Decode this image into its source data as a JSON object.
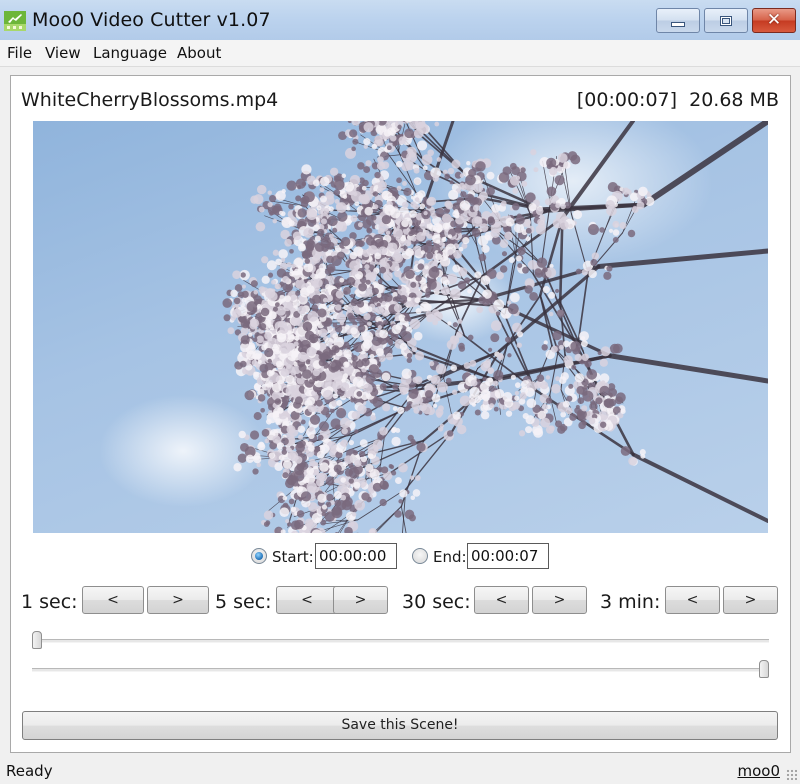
{
  "window": {
    "title": "Moo0 Video Cutter v1.07",
    "app_icon": "clapperboard-icon",
    "controls": {
      "minimize": "minimize-icon",
      "maximize": "maximize-icon",
      "close": "close-icon"
    }
  },
  "menu": {
    "items": [
      {
        "label": "File"
      },
      {
        "label": "View"
      },
      {
        "label": "Language"
      },
      {
        "label": "About"
      }
    ]
  },
  "file": {
    "name": "WhiteCherryBlossoms.mp4",
    "duration": "[00:00:07]",
    "size": "20.68 MB",
    "info": "[00:00:07]  20.68 MB"
  },
  "video": {
    "content": "cherry blossom branches against blue sky"
  },
  "range": {
    "selected": "start",
    "start_label": "Start:",
    "start_value": "00:00:00",
    "end_label": "End:",
    "end_value": "00:00:07"
  },
  "steps": [
    {
      "label": "1 sec:",
      "back": "<",
      "forward": ">"
    },
    {
      "label": "5 sec:",
      "back": "<",
      "forward": ">"
    },
    {
      "label": "30 sec:",
      "back": "<",
      "forward": ">"
    },
    {
      "label": "3 min:",
      "back": "<",
      "forward": ">"
    }
  ],
  "sliders": {
    "start_position_fraction": 0.0,
    "end_position_fraction": 1.0
  },
  "actions": {
    "save_label": "Save this Scene!"
  },
  "status": {
    "text": "Ready",
    "link": "moo0"
  }
}
